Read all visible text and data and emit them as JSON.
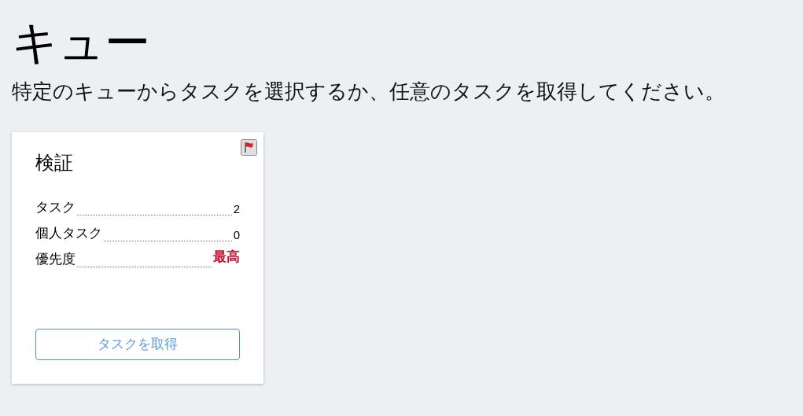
{
  "page": {
    "title": "キュー",
    "subtitle": "特定のキューからタスクを選択するか、任意のタスクを取得してください。"
  },
  "queues": [
    {
      "name": "検証",
      "flagged": true,
      "stats": [
        {
          "kind": "count",
          "label": "タスク",
          "value": "2"
        },
        {
          "kind": "count",
          "label": "個人タスク",
          "value": "0"
        },
        {
          "kind": "priority",
          "label": "優先度",
          "value": "最高"
        }
      ],
      "button": "タスクを取得"
    }
  ]
}
